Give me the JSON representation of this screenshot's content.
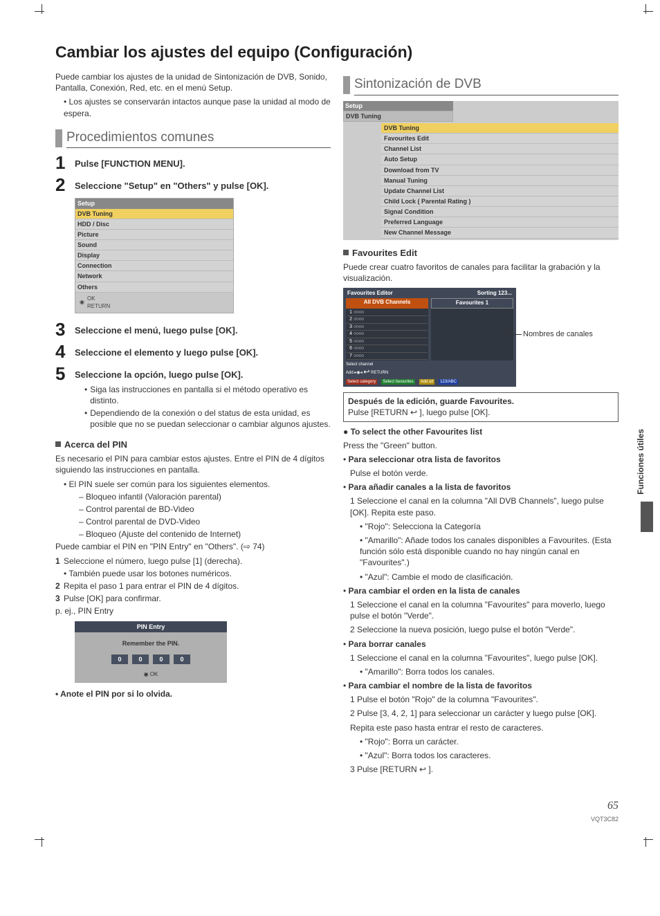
{
  "page_title": "Cambiar los ajustes del equipo (Configuración)",
  "intro": {
    "p1": "Puede cambiar los ajustes de la unidad de Sintonización de DVB, Sonido, Pantalla, Conexión, Red, etc. en el menú Setup.",
    "b1": "Los ajustes se conservarán intactos aunque pase la unidad al modo de espera."
  },
  "left": {
    "section_title": "Procedimientos comunes",
    "steps": {
      "1": "Pulse [FUNCTION MENU].",
      "2": "Seleccione \"Setup\" en \"Others\" y pulse [OK].",
      "3": "Seleccione el menú, luego pulse [OK].",
      "4": "Seleccione el elemento y luego pulse [OK].",
      "5": "Seleccione la opción, luego pulse [OK]."
    },
    "step5_bullets": [
      "Siga las instrucciones en pantalla si el método operativo es distinto.",
      "Dependiendo de la conexión o del status de esta unidad, es posible que no se puedan seleccionar o cambiar algunos ajustes."
    ],
    "setup_box": {
      "header": "Setup",
      "rows": [
        "DVB Tuning",
        "HDD / Disc",
        "Picture",
        "Sound",
        "Display",
        "Connection",
        "Network",
        "Others"
      ],
      "foot_ok": "OK",
      "foot_return": "RETURN"
    },
    "pin_head": "Acerca del PIN",
    "pin_p1": "Es necesario el PIN para cambiar estos ajustes. Entre el PIN de 4 dígitos siguiendo las instrucciones en pantalla.",
    "pin_b1": "El PIN suele ser común para los siguientes elementos.",
    "pin_dashes": [
      "Bloqueo infantil (Valoración parental)",
      "Control parental de BD-Video",
      "Control parental de DVD-Video",
      "Bloqueo (Ajuste del contenido de Internet)"
    ],
    "pin_p2": "Puede cambiar el PIN en \"PIN Entry\" en \"Others\". (⇨ 74)",
    "pin_steps": [
      {
        "n": "1",
        "t": "Seleccione el número, luego pulse [1] (derecha)."
      },
      {
        "n": "",
        "t": "• También puede usar los botones numéricos."
      },
      {
        "n": "2",
        "t": "Repita el paso 1 para entrar el PIN de 4 dígitos."
      },
      {
        "n": "3",
        "t": "Pulse [OK] para confirmar."
      }
    ],
    "pin_eg": "p. ej., PIN Entry",
    "pin_box": {
      "header": "PIN Entry",
      "msg": "Remember the PIN.",
      "digits": [
        "0",
        "0",
        "0",
        "0"
      ],
      "ok": "OK"
    },
    "pin_note": "• Anote el PIN por si lo olvida."
  },
  "right": {
    "section_title": "Sintonización de DVB",
    "dvb_box": {
      "top": "Setup",
      "tab": "DVB Tuning",
      "items": [
        "DVB Tuning",
        "Favourites Edit",
        "Channel List",
        "Auto Setup",
        "Download from TV",
        "Manual Tuning",
        "Update Channel List",
        "Child Lock ( Parental Rating )",
        "Signal Condition",
        "Preferred Language",
        "New Channel Message"
      ]
    },
    "fav_head": "Favourites Edit",
    "fav_p1": "Puede crear cuatro favoritos de canales para facilitar la grabación y la visualización.",
    "fav_box": {
      "title": "Favourites Editor",
      "sort": "Sorting 123...",
      "col1": "All DVB Channels",
      "col2": "Favourites 1",
      "rows": [
        "1",
        "2",
        "3",
        "4",
        "5",
        "6",
        "7"
      ],
      "placeholder": "○○○○",
      "select": "Select channel",
      "add": "Add",
      "return": "RETURN",
      "btns": [
        "Select category",
        "Select favourites",
        "Add all",
        "123/ABC"
      ]
    },
    "fav_label": "Nombres de canales",
    "note_box": {
      "b": "Después de la edición, guarde Favourites.",
      "t": "Pulse [RETURN ↩ ], luego pulse [OK]."
    },
    "sel_other_h": "● To select the other Favourites list",
    "sel_other_t": "Press the \"Green\" button.",
    "items": [
      {
        "h": "Para seleccionar otra lista de favoritos",
        "lines": [
          "Pulse el botón verde."
        ]
      },
      {
        "h": "Para añadir canales a la lista de favoritos",
        "lines": [
          "1 Seleccione el canal en la columna \"All DVB Channels\", luego pulse [OK]. Repita este paso.",
          "• \"Rojo\": Selecciona la Categoría",
          "• \"Amarillo\": Añade todos los canales disponibles a Favourites. (Esta función sólo está disponible cuando no hay ningún canal en \"Favourites\".)",
          "• \"Azul\": Cambie el modo de clasificación."
        ]
      },
      {
        "h": "Para cambiar el orden en la lista de canales",
        "lines": [
          "1 Seleccione el canal en la columna \"Favourites\" para moverlo, luego pulse el botón \"Verde\".",
          "2 Seleccione la nueva posición, luego pulse el botón \"Verde\"."
        ]
      },
      {
        "h": "Para borrar canales",
        "lines": [
          "1 Seleccione el canal en la columna \"Favourites\", luego pulse [OK].",
          "• \"Amarillo\": Borra todos los canales."
        ]
      },
      {
        "h": "Para cambiar el nombre de la lista de favoritos",
        "lines": [
          "1 Pulse el botón \"Rojo\" de la columna \"Favourites\".",
          "2 Pulse [3, 4, 2, 1] para seleccionar un carácter y luego pulse [OK].",
          "Repita este paso hasta entrar el resto de caracteres.",
          "• \"Rojo\": Borra un carácter.",
          "• \"Azul\": Borra todos los caracteres.",
          "3 Pulse [RETURN ↩ ]."
        ]
      }
    ]
  },
  "side_label": "Funciones útiles",
  "page_num": "65",
  "doc_code": "VQT3C82"
}
